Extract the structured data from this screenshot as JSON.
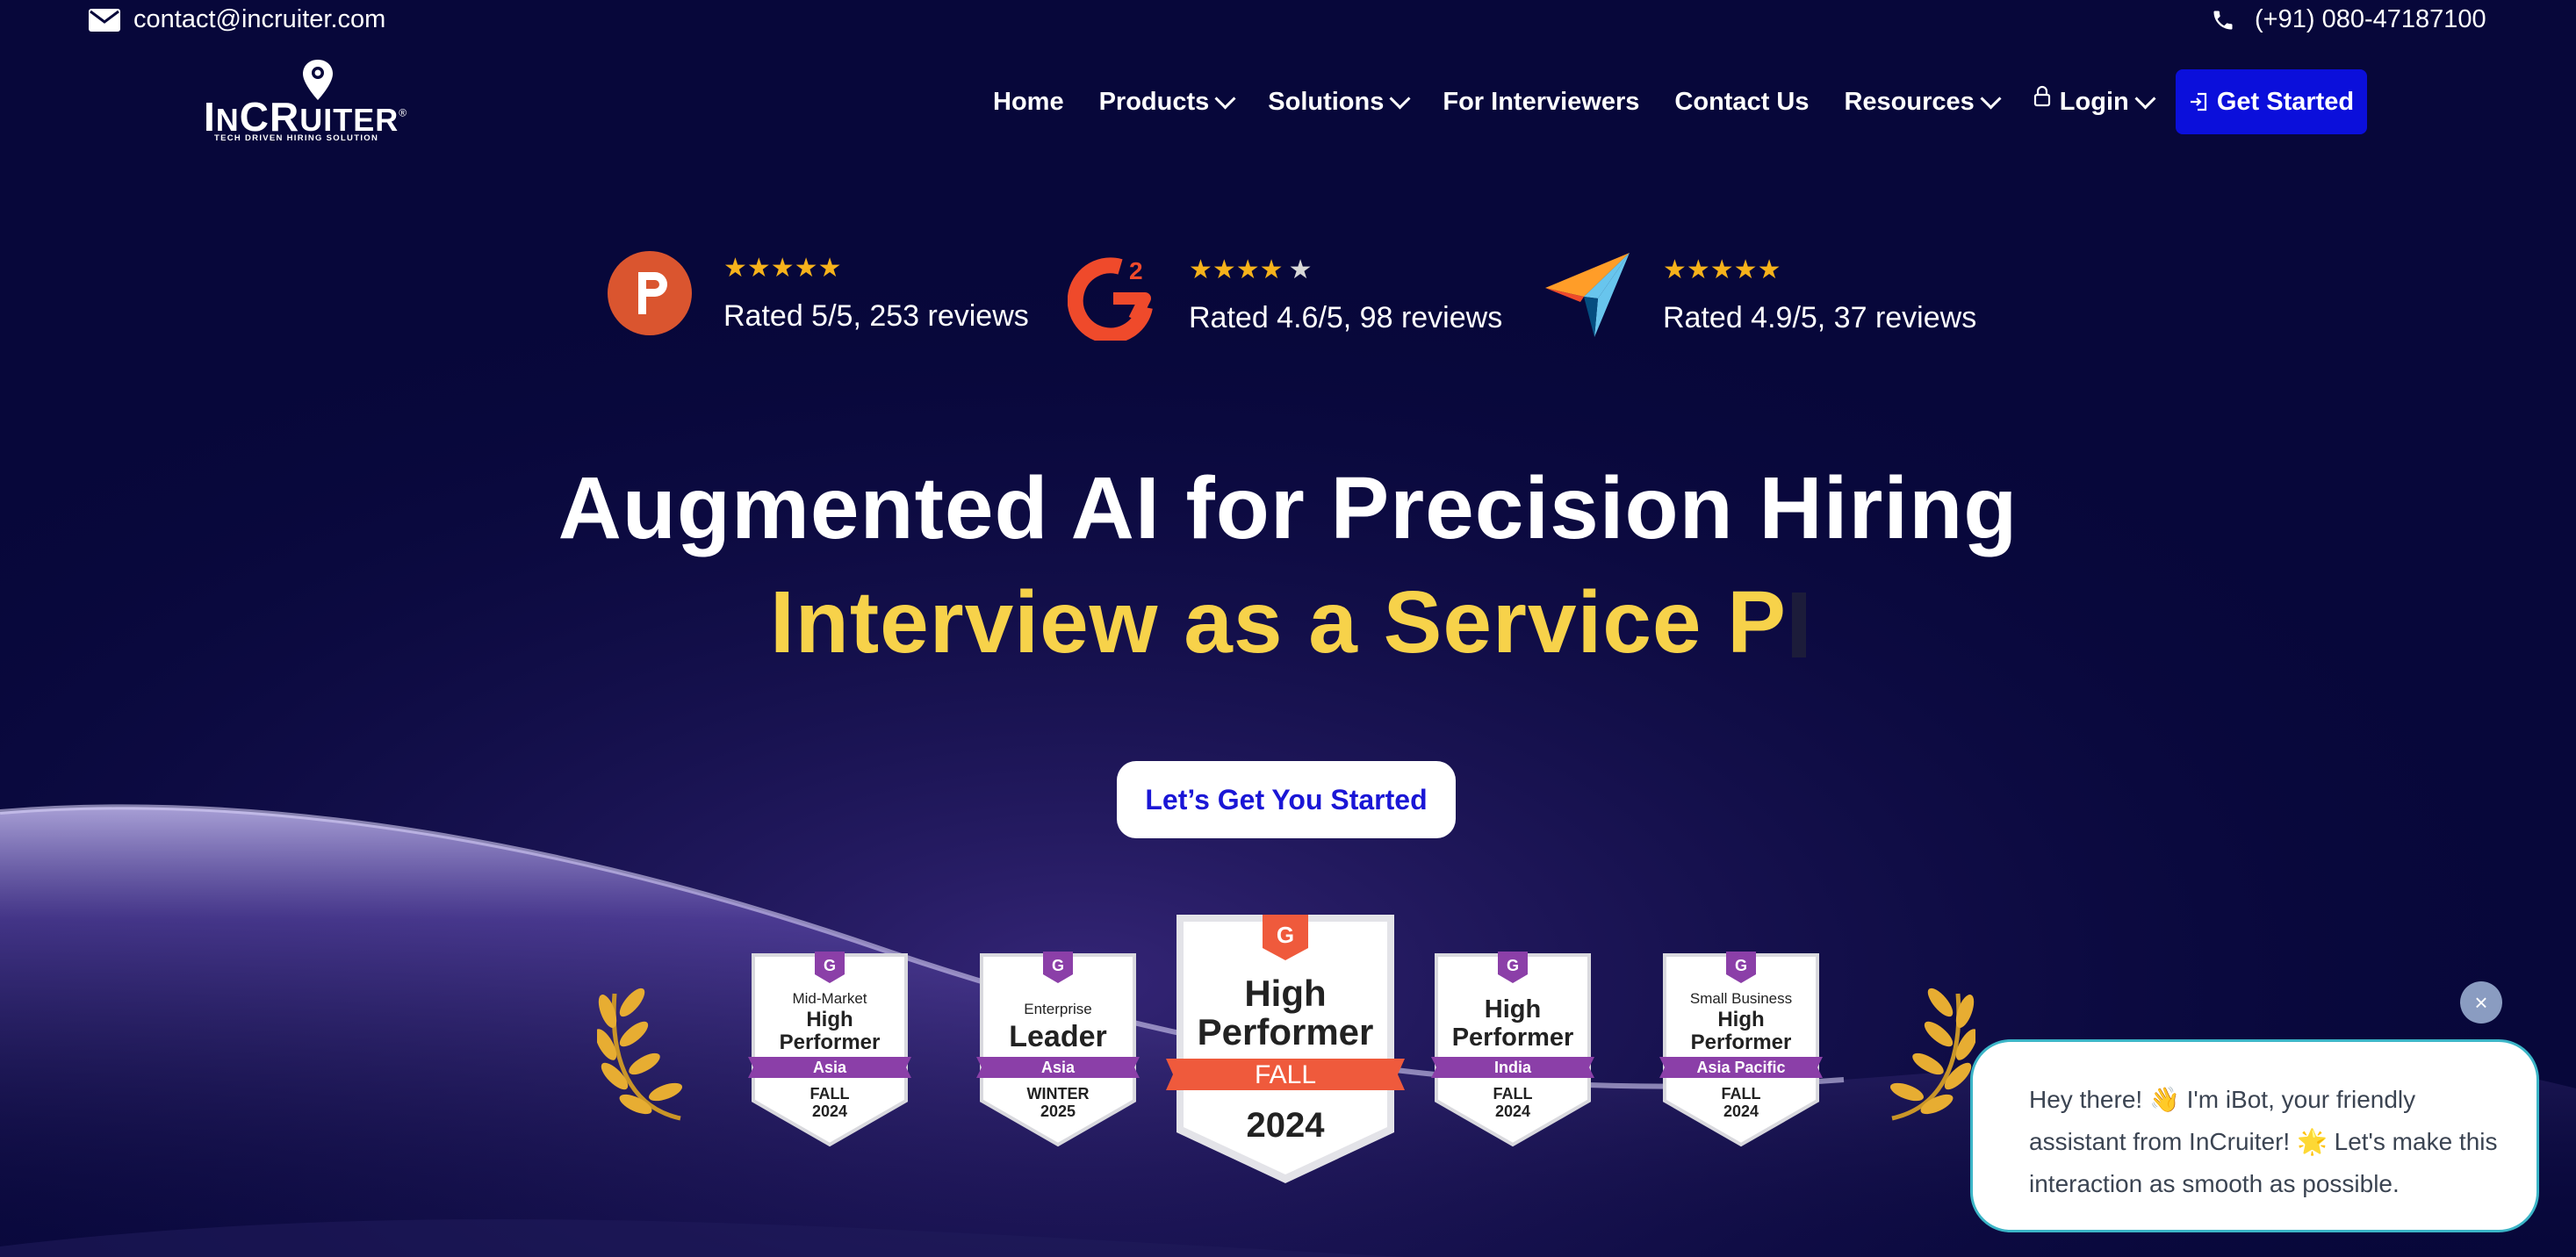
{
  "topbar": {
    "email": "contact@incruiter.com",
    "phone": "(+91) 080-47187100"
  },
  "logo": {
    "word": "INCRUITER",
    "tagline": "TECH DRIVEN HIRING SOLUTION"
  },
  "nav": {
    "items": [
      {
        "label": "Home",
        "dropdown": false
      },
      {
        "label": "Products",
        "dropdown": true
      },
      {
        "label": "Solutions",
        "dropdown": true
      },
      {
        "label": "For Interviewers",
        "dropdown": false
      },
      {
        "label": "Contact Us",
        "dropdown": false
      },
      {
        "label": "Resources",
        "dropdown": true
      },
      {
        "label": "Login",
        "dropdown": true
      }
    ],
    "cta": "Get Started"
  },
  "ratings": [
    {
      "platform_icon": "product-hunt-icon",
      "stars": 5,
      "text": "Rated 5/5, 253 reviews"
    },
    {
      "platform_icon": "g2-icon",
      "stars": 4.6,
      "text": "Rated 4.6/5, 98 reviews"
    },
    {
      "platform_icon": "capterra-icon",
      "stars": 4.9,
      "text": "Rated 4.9/5, 37 reviews"
    }
  ],
  "hero": {
    "headline": "Augmented AI for Precision Hiring",
    "typed_text": "Interview as a Service P",
    "cta": "Let’s Get You Started"
  },
  "badges": [
    {
      "top": "Mid-Market",
      "title1": "High",
      "title2": "Performer",
      "region": "Asia",
      "season": "FALL",
      "year": "2024"
    },
    {
      "top": "Enterprise",
      "title1": "Leader",
      "title2": "",
      "region": "Asia",
      "season": "WINTER",
      "year": "2025"
    },
    {
      "top": "",
      "title1": "High",
      "title2": "Performer",
      "region": "FALL",
      "season": "",
      "year": "2024"
    },
    {
      "top": "",
      "title1": "High",
      "title2": "Performer",
      "region": "India",
      "season": "FALL",
      "year": "2024"
    },
    {
      "top": "Small Business",
      "title1": "High",
      "title2": "Performer",
      "region": "Asia Pacific",
      "season": "FALL",
      "year": "2024"
    }
  ],
  "chat": {
    "message": "Hey there! 👋 I'm iBot, your friendly assistant from InCruiter! 🌟 Let's make this interaction as smooth as possible.",
    "close": "×"
  },
  "colors": {
    "background": "#07073a",
    "accent_blue": "#0b0fdb",
    "highlight_yellow": "#f7d24a",
    "star": "#f6b21b",
    "badge_purple": "#8b3fa8",
    "g2_red": "#ef5a3c"
  }
}
